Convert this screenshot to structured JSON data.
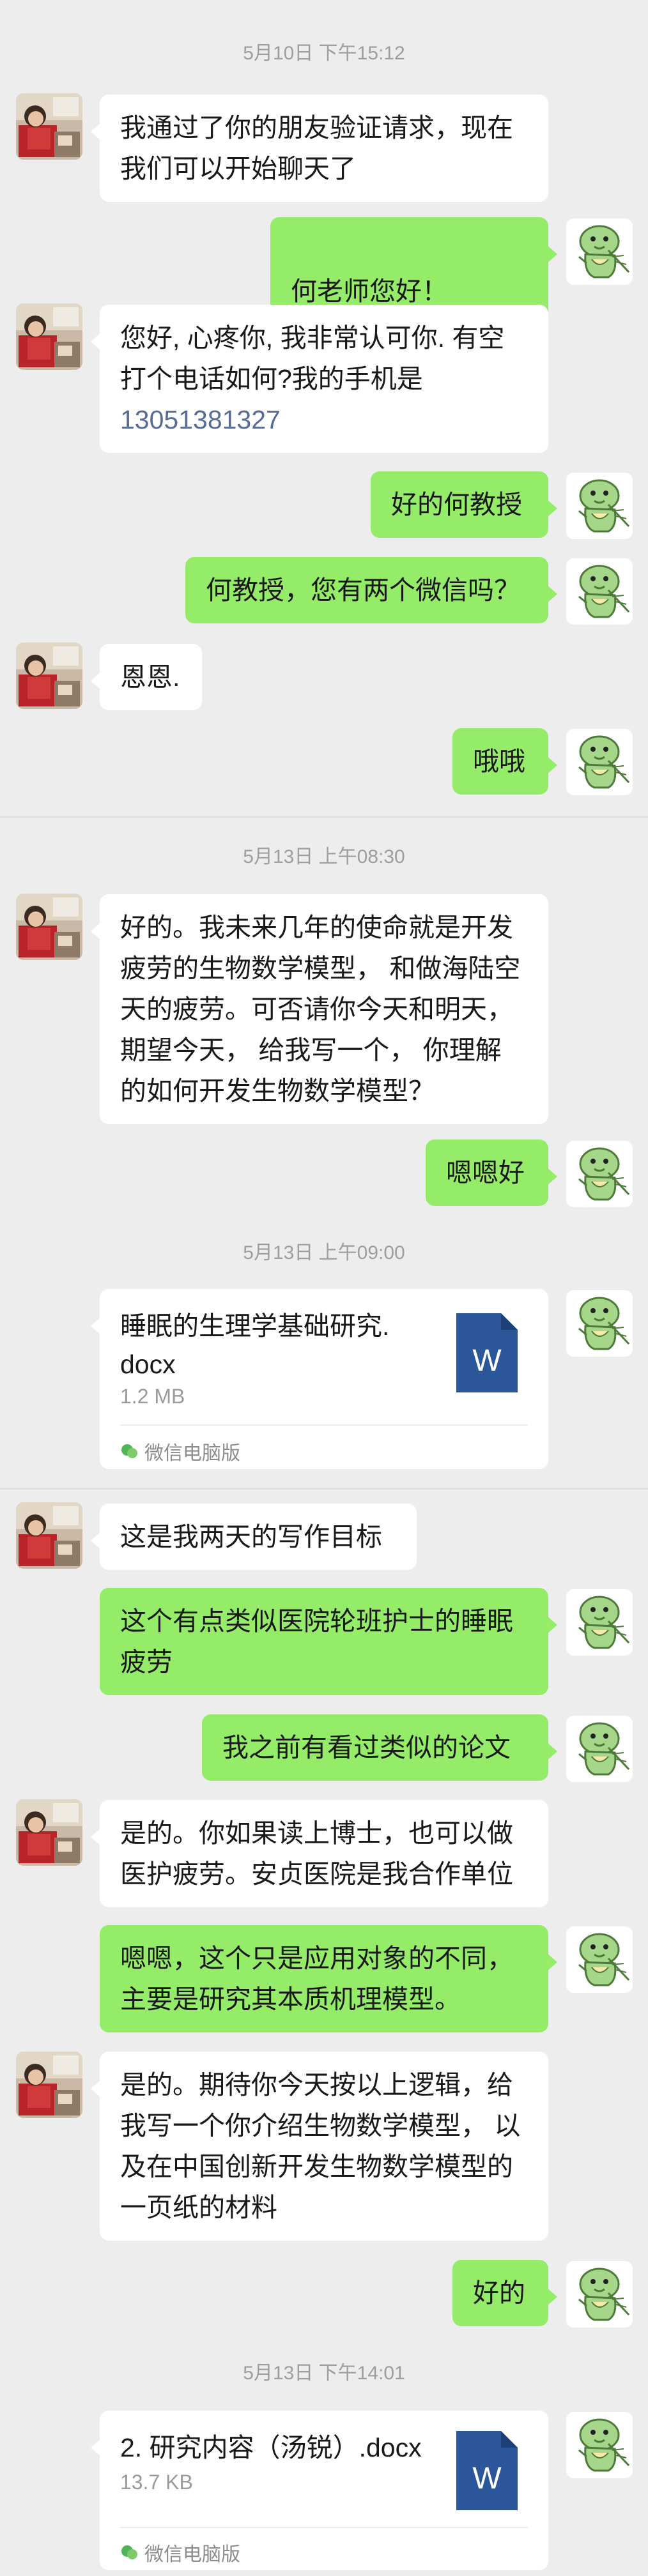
{
  "timestamps": [
    "5月10日 下午15:12",
    "5月13日 上午08:30",
    "5月13日 上午09:00",
    "5月13日 下午14:01"
  ],
  "messages": {
    "m1": "我通过了你的朋友验证请求，现在\n我们可以开始聊天了",
    "m2": "何老师您好！",
    "m3_text": "您好, 心疼你, 我非常认可你. 有空\n打个电话如何?我的手机是",
    "m3_phone": "13051381327",
    "m4": "好的何教授",
    "m5": "何教授，您有两个微信吗？",
    "m6": "恩恩.",
    "m7": "哦哦",
    "m8": "好的。我未来几年的使命就是开发\n疲劳的生物数学模型， 和做海陆空\n天的疲劳。可否请你今天和明天，\n期望今天， 给我写一个， 你理解\n的如何开发生物数学模型？",
    "m9": "嗯嗯好",
    "m10": "这是我两天的写作目标",
    "m11": "这个有点类似医院轮班护士的睡眠\n疲劳",
    "m12": "我之前有看过类似的论文",
    "m13": "是的。你如果读上博士，也可以做\n医护疲劳。安贞医院是我合作单位",
    "m14": " 嗯嗯，这个只是应用对象的不同，\n主要是研究其本质机理模型。",
    "m15": "是的。期待你今天按以上逻辑，给\n我写一个你介绍生物数学模型， 以\n及在中国创新开发生物数学模型的\n一页纸的材料",
    "m16": "好的"
  },
  "files": [
    {
      "name": "睡眠的生理学基础研究.\ndocx",
      "size": "1.2 MB",
      "source": "微信电脑版",
      "icon": "word-icon"
    },
    {
      "name": "2. 研究内容（汤锐）.docx",
      "size": "13.7 KB",
      "source": "微信电脑版",
      "icon": "word-icon"
    }
  ],
  "colors": {
    "background": "#ededed",
    "outgoing_bubble": "#95ec69",
    "incoming_bubble": "#ffffff",
    "phone_link": "#576b95",
    "word_icon": "#2b579a"
  },
  "avatars": {
    "incoming": "photo-avatar",
    "outgoing": "dinosaur-sticker-avatar"
  }
}
